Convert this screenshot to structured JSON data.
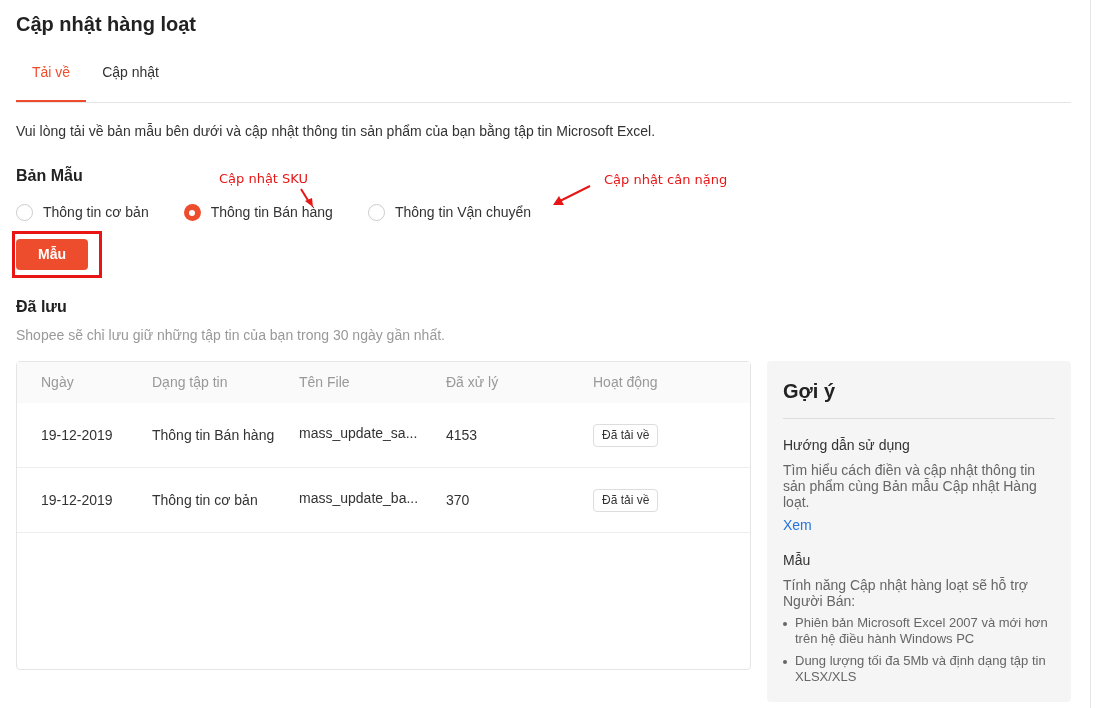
{
  "title": "Cập nhật hàng loạt",
  "tabs": [
    {
      "label": "Tải về",
      "selected": true
    },
    {
      "label": "Cập nhật",
      "selected": false
    }
  ],
  "description": "Vui lòng tải về bản mẫu bên dưới và cập nhật thông tin sản phẩm của bạn bằng tập tin Microsoft Excel.",
  "template": {
    "heading": "Bản Mẫu",
    "options": [
      {
        "label": "Thông tin cơ bản",
        "selected": false
      },
      {
        "label": "Thông tin Bán hàng",
        "selected": true
      },
      {
        "label": "Thông tin Vận chuyển",
        "selected": false
      }
    ],
    "button": "Mẫu"
  },
  "annotations": [
    {
      "text": "Cập nhật SKU",
      "kind": "down"
    },
    {
      "text": "Cập nhật cân nặng",
      "kind": "left"
    }
  ],
  "saved": {
    "heading": "Đã lưu",
    "note": "Shopee sẽ chỉ lưu giữ những tập tin của bạn trong 30 ngày gần nhất.",
    "columns": [
      "Ngày",
      "Dạng tập tin",
      "Tên File",
      "Đã xử lý",
      "Hoạt động"
    ],
    "rows": [
      {
        "date": "19-12-2019",
        "type": "Thông tin Bán hàng",
        "file": "mass_update_sa...",
        "processed": "4153",
        "action": "Đã tải về"
      },
      {
        "date": "19-12-2019",
        "type": "Thông tin cơ bản",
        "file": "mass_update_ba...",
        "processed": "370",
        "action": "Đã tải về"
      }
    ]
  },
  "tips": {
    "title": "Gợi ý",
    "sections": [
      {
        "heading": "Hướng dẫn sử dụng",
        "text": "Tìm hiểu cách điền và cập nhật thông tin sản phẩm cùng Bản mẫu Cập nhật Hàng loạt.",
        "link": "Xem"
      },
      {
        "heading": "Mẫu",
        "text": "Tính năng Cập nhật hàng loạt sẽ hỗ trợ Người Bán:",
        "bullets": [
          "Phiên bản Microsoft Excel 2007 và mới hơn trên hệ điều hành Windows PC",
          "Dung lượng tối đa 5Mb và định dạng tập tin XLSX/XLS"
        ]
      }
    ]
  }
}
